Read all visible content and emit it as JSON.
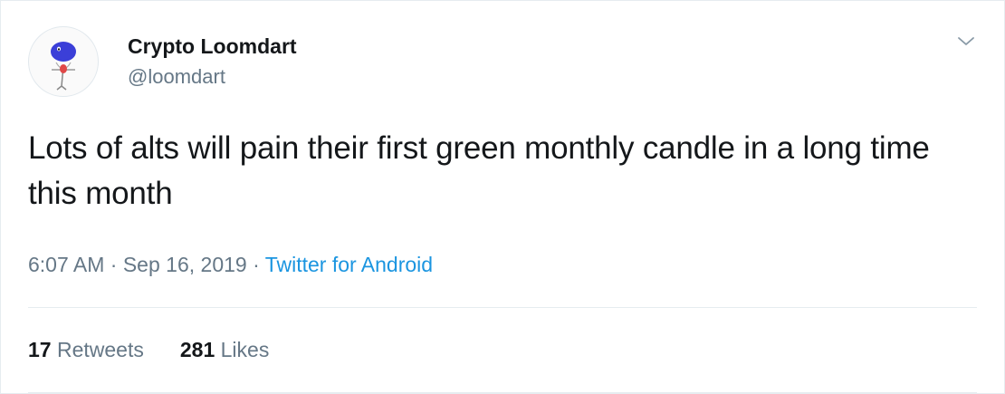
{
  "user": {
    "display_name": "Crypto Loomdart",
    "handle": "@loomdart",
    "avatar_icon": "cartoon-avatar-icon"
  },
  "menu": {
    "icon": "chevron-down-icon"
  },
  "tweet": {
    "text": "Lots of alts will pain their first green monthly candle in a long time this month"
  },
  "meta": {
    "time": "6:07 AM",
    "sep1": " · ",
    "date": "Sep 16, 2019",
    "sep2": " · ",
    "source": "Twitter for Android"
  },
  "stats": {
    "retweets_count": "17",
    "retweets_label": "Retweets",
    "likes_count": "281",
    "likes_label": "Likes"
  },
  "colors": {
    "text": "#14171a",
    "secondary": "#657786",
    "link": "#1b95e0",
    "border": "#e6ecf0"
  }
}
